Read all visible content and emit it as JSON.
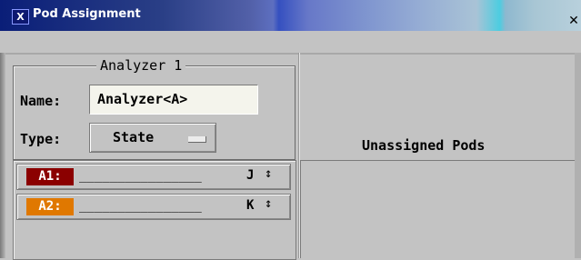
{
  "window": {
    "title": "Pod Assignment",
    "icon": "x-window-icon",
    "close_label": "✕"
  },
  "analyzer": {
    "heading": "Analyzer 1",
    "name_label": "Name:",
    "name_value": "Analyzer<A>",
    "type_label": "Type:",
    "type_value": "State"
  },
  "unassigned_heading": "Unassigned Pods",
  "pods": [
    {
      "label": "A1:",
      "color": "#8b0000",
      "dashes": "________________",
      "letter": "J",
      "arrow": "↕"
    },
    {
      "label": "A2:",
      "color": "#e07800",
      "dashes": "________________",
      "letter": "K",
      "arrow": "↕"
    }
  ]
}
